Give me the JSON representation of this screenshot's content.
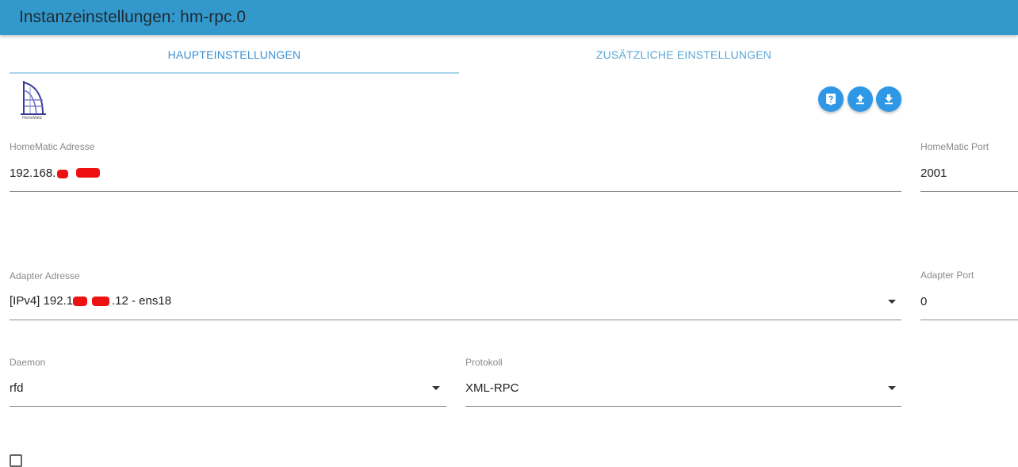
{
  "header": {
    "title": "Instanzeinstellungen: hm-rpc.0"
  },
  "tabs": [
    {
      "label": "HAUPTEINSTELLUNGEN",
      "active": true
    },
    {
      "label": "ZUSÄTZLICHE EINSTELLUNGEN",
      "active": false
    }
  ],
  "logo": {
    "icon": "homematic-logo",
    "text": "HomeMatic"
  },
  "toolbar": {
    "help_icon": "help-icon",
    "upload_icon": "upload-icon",
    "download_icon": "download-icon",
    "accent": "#2e97e6"
  },
  "fields": {
    "homematic_address": {
      "label": "HomeMatic Adresse",
      "value": "192.168."
    },
    "homematic_port": {
      "label": "HomeMatic Port",
      "value": "2001"
    },
    "adapter_address": {
      "label": "Adapter Adresse",
      "value_prefix": "[IPv4] 192.1",
      "value_suffix": ".12 - ens18"
    },
    "adapter_port": {
      "label": "Adapter Port",
      "value": "0"
    },
    "daemon": {
      "label": "Daemon",
      "value": "rfd"
    },
    "protocol": {
      "label": "Protokoll",
      "value": "XML-RPC"
    }
  },
  "colors": {
    "header": "#3399cc",
    "tab_active": "#3a8fd1",
    "redaction": "#ee1111"
  }
}
